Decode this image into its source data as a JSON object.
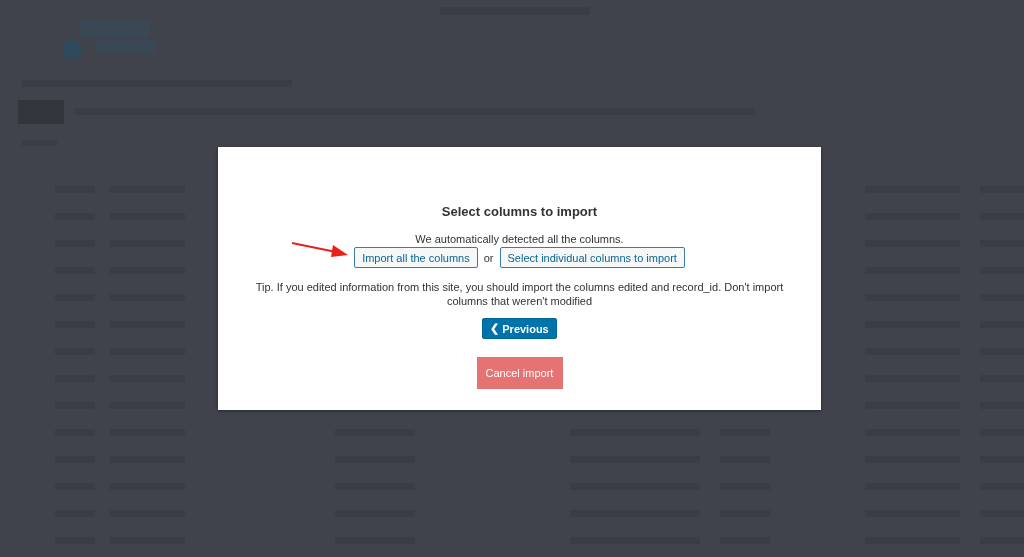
{
  "modal": {
    "title": "Select columns to import",
    "intro": "We automatically detected all the columns.",
    "import_all_button": "Import all the columns",
    "separator": "or",
    "select_columns_button": "Select individual columns to import",
    "tip": "Tip. If you edited information from this site, you should import the columns edited and record_id. Don't import columns that weren't modified",
    "previous_button": {
      "icon": "❮",
      "label": "Previous"
    },
    "cancel_button": "Cancel import"
  }
}
